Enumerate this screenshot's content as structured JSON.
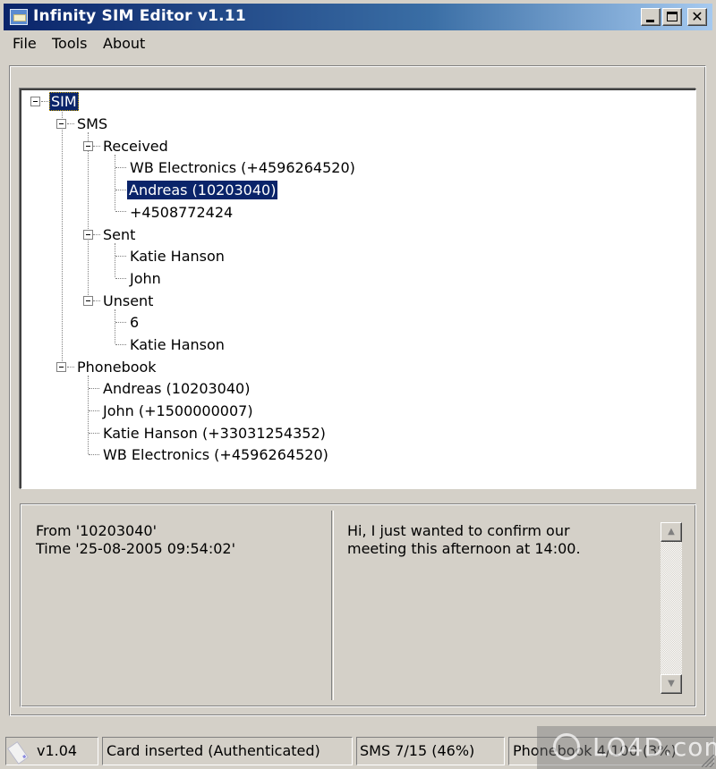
{
  "window": {
    "title": "Infinity SIM Editor v1.11",
    "controls": {
      "minimize": "_",
      "maximize": "□",
      "close": "✕"
    }
  },
  "menu": [
    {
      "label": "File"
    },
    {
      "label": "Tools"
    },
    {
      "label": "About"
    }
  ],
  "tree": {
    "root": {
      "label": "SIM",
      "expanded": true,
      "selected_highlight": true,
      "focused": true
    },
    "sms": {
      "label": "SMS",
      "expanded": true,
      "received": {
        "label": "Received",
        "expanded": true,
        "items": [
          "WB Electronics (+4596264520)",
          "Andreas (10203040)",
          "+4508772424"
        ],
        "selected_index": 1
      },
      "sent": {
        "label": "Sent",
        "expanded": true,
        "items": [
          "Katie Hanson",
          "John"
        ]
      },
      "unsent": {
        "label": "Unsent",
        "expanded": true,
        "items": [
          "6",
          "Katie Hanson"
        ]
      }
    },
    "phonebook": {
      "label": "Phonebook",
      "expanded": true,
      "items": [
        "Andreas (10203040)",
        "John (+1500000007)",
        "Katie Hanson (+33031254352)",
        "WB Electronics (+4596264520)"
      ]
    }
  },
  "details": {
    "from_line": "From '10203040'",
    "time_line": "Time '25-08-2005 09:54:02'"
  },
  "message": {
    "line1": "Hi, I just wanted to confirm our",
    "line2": "meeting this afternoon at 14:00."
  },
  "statusbar": {
    "version": "v1.04",
    "card_status": "Card inserted (Authenticated)",
    "sms": "SMS 7/15 (46%)",
    "phonebook": "Phonebook 4/100 (3%)"
  },
  "watermark": "LO4D.com",
  "colors": {
    "selection": "#0a246a",
    "titlebar_start": "#0a246a",
    "titlebar_end": "#a6caf0",
    "face": "#d4d0c8"
  }
}
